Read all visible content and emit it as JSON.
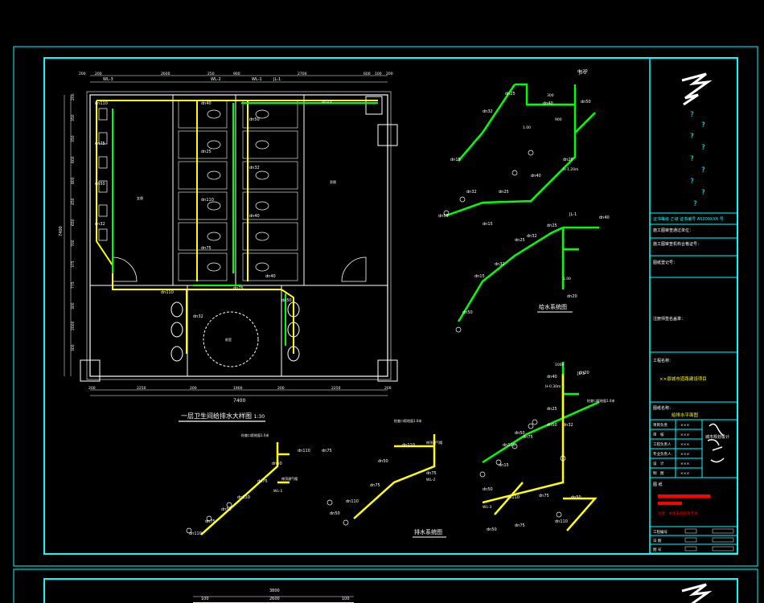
{
  "plan": {
    "title": "一层卫生间给排水大样图",
    "scale": "1:30",
    "top_dims": [
      "200",
      "200",
      "2600",
      "250",
      "900",
      "2700",
      "600",
      "100",
      "200"
    ],
    "bottom_dims": [
      "200",
      "2250",
      "200",
      "1900",
      "200",
      "2250",
      "200"
    ],
    "total_width": "7400",
    "left_dims": [
      "200",
      "350",
      "350",
      "600",
      "800",
      "450",
      "650",
      "700",
      "375",
      "775",
      "300",
      "2000",
      "300"
    ],
    "total_height": "7400",
    "pipe_labels_top": [
      "WL-3",
      "WL-2",
      "WL-1",
      "JL-1"
    ],
    "room_labels": [
      "女厕",
      "男厕",
      "前室"
    ],
    "dims_lower": [
      "450",
      "900",
      "1400",
      "900",
      "500"
    ],
    "dims_mid": [
      "800",
      "450",
      "650"
    ],
    "sizes": [
      "dn110",
      "dn75",
      "dn50",
      "dn32",
      "dn40",
      "dn25"
    ]
  },
  "systems": {
    "water_supply_title": "给水系统图",
    "drainage_title": "排水系统图",
    "jl_labels": [
      "JL-2",
      "JL-1",
      "JL-3"
    ],
    "wl_labels": [
      "WL-1",
      "WL-2",
      "WL-3"
    ],
    "supply_sizes": [
      "dn32",
      "dn25",
      "dn40",
      "dn20",
      "dn50",
      "dn15"
    ],
    "elevations": [
      "1.00",
      "H-0.30m",
      "H-1.20m"
    ],
    "drain_sizes": [
      "dn110",
      "dn75",
      "dn50"
    ],
    "note": "检查口距地面1.0米",
    "vent_note": "伸顶通气帽",
    "dims": [
      "900",
      "1000",
      "300"
    ]
  },
  "title_block": {
    "cert_row": "证书等级 乙级   证书编号 A5200XXX 号",
    "fields": [
      "施工图审查通过单位：",
      "施工图审查机构合格证号：",
      "图纸登记号："
    ],
    "sign_label": "注册师签名盖章：",
    "project_label": "工程名称：",
    "project_name": "××县城市道路建设项目",
    "sheet_label": "图纸名称：",
    "sheet_name": "给排水平面图",
    "rows": [
      [
        "项目负责",
        "×××"
      ],
      [
        "审　核",
        "×××"
      ],
      [
        "工程负责人",
        "×××"
      ],
      [
        "专业负责人",
        "×××"
      ],
      [
        "设　计",
        "×××"
      ],
      [
        "制　图",
        "×××"
      ]
    ],
    "stamp": "城市规划设计",
    "note_label": "图 纸",
    "note_box": "注意：本图未经盖章无效",
    "footer": [
      [
        "工程编号",
        ""
      ],
      [
        "日 期",
        ""
      ],
      [
        "图 号",
        ""
      ]
    ]
  },
  "second_sheet": {
    "dims": [
      "3800",
      "100",
      "2600",
      "100"
    ]
  }
}
